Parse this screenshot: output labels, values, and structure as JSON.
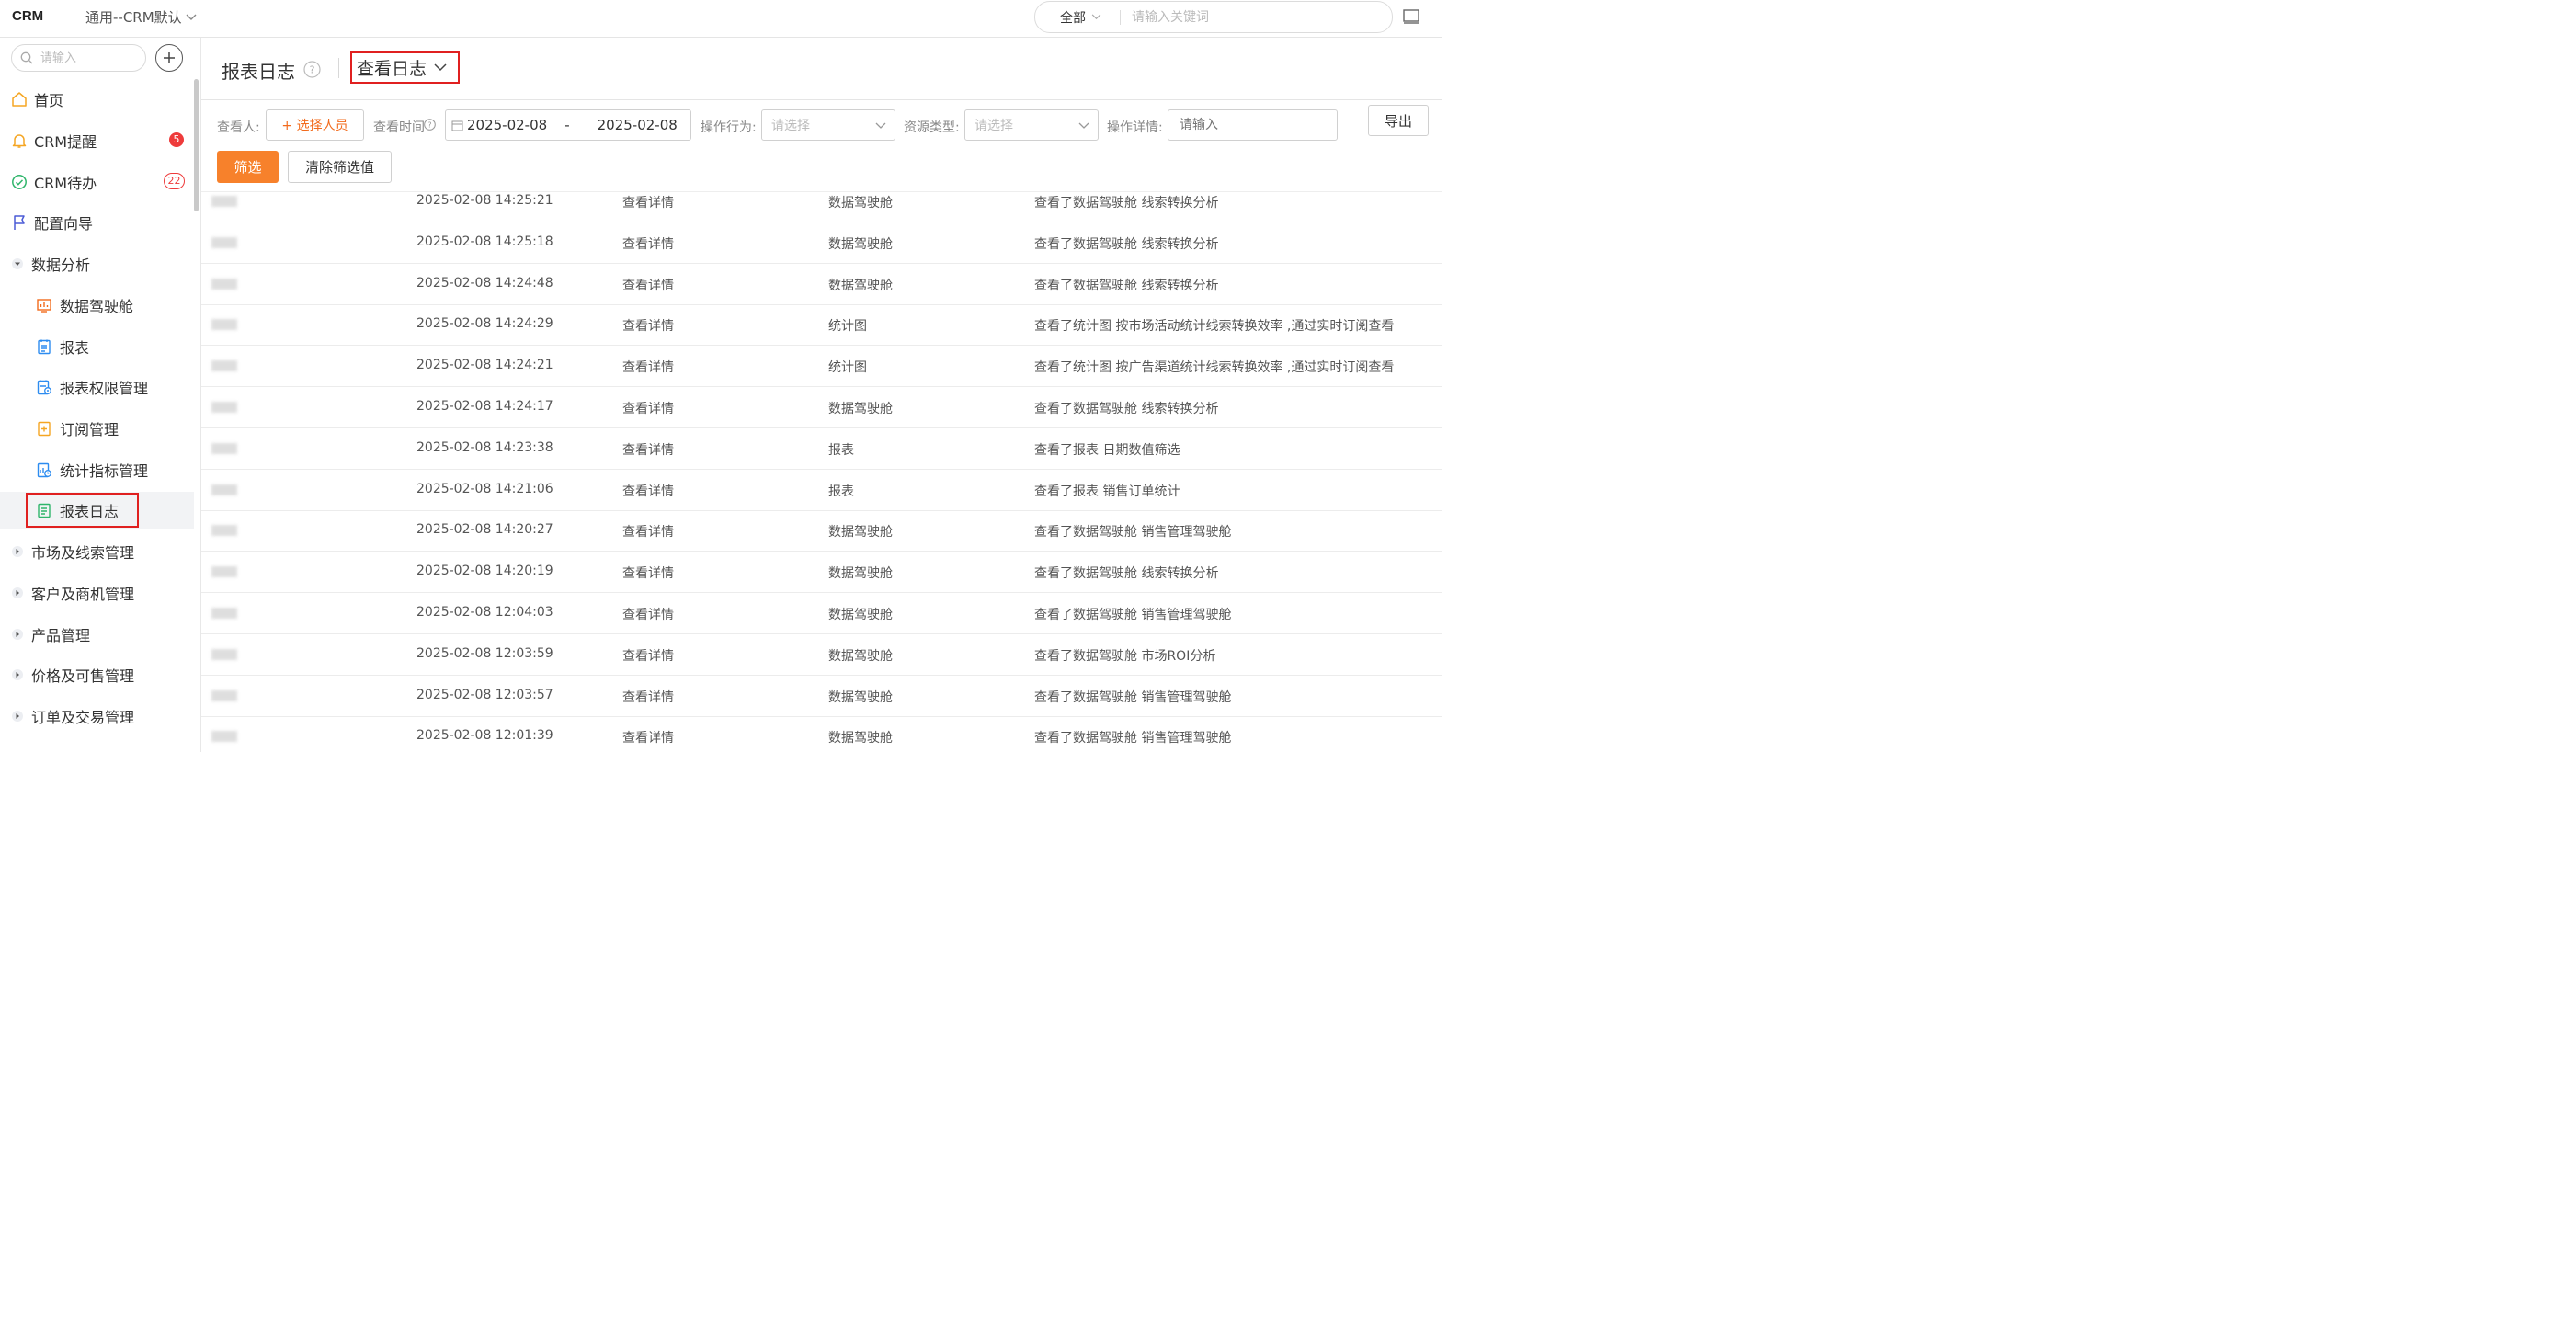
{
  "topbar": {
    "logo": "CRM",
    "app_name": "通用--CRM默认",
    "search_scope": "全部",
    "search_placeholder": "请输入关键词"
  },
  "sidebar": {
    "search_placeholder": "请输入",
    "items": [
      {
        "label": "首页"
      },
      {
        "label": "CRM提醒",
        "badge": "5"
      },
      {
        "label": "CRM待办",
        "badge": "22"
      },
      {
        "label": "配置向导"
      },
      {
        "label": "数据分析",
        "expanded": true
      },
      {
        "label": "数据驾驶舱"
      },
      {
        "label": "报表"
      },
      {
        "label": "报表权限管理"
      },
      {
        "label": "订阅管理"
      },
      {
        "label": "统计指标管理"
      },
      {
        "label": "报表日志",
        "active": true
      },
      {
        "label": "市场及线索管理"
      },
      {
        "label": "客户及商机管理"
      },
      {
        "label": "产品管理"
      },
      {
        "label": "价格及可售管理"
      },
      {
        "label": "订单及交易管理"
      }
    ]
  },
  "main": {
    "title": "报表日志",
    "view_switch": "查看日志",
    "filters": {
      "viewer_label": "查看人:",
      "viewer_button": "+ 选择人员",
      "time_label": "查看时间",
      "date_start": "2025-02-08",
      "date_sep": "-",
      "date_end": "2025-02-08",
      "action_label": "操作行为:",
      "action_placeholder": "请选择",
      "resource_label": "资源类型:",
      "resource_placeholder": "请选择",
      "detail_label": "操作详情:",
      "detail_placeholder": "请输入",
      "export": "导出",
      "filter": "筛选",
      "clear": "清除筛选值"
    },
    "rows": [
      {
        "time": "2025-02-08 14:25:21",
        "action": "查看详情",
        "type": "数据驾驶舱",
        "detail": "查看了数据驾驶舱 线索转换分析"
      },
      {
        "time": "2025-02-08 14:25:18",
        "action": "查看详情",
        "type": "数据驾驶舱",
        "detail": "查看了数据驾驶舱 线索转换分析"
      },
      {
        "time": "2025-02-08 14:24:48",
        "action": "查看详情",
        "type": "数据驾驶舱",
        "detail": "查看了数据驾驶舱 线索转换分析"
      },
      {
        "time": "2025-02-08 14:24:29",
        "action": "查看详情",
        "type": "统计图",
        "detail": "查看了统计图 按市场活动统计线索转换效率 ,通过实时订阅查看"
      },
      {
        "time": "2025-02-08 14:24:21",
        "action": "查看详情",
        "type": "统计图",
        "detail": "查看了统计图 按广告渠道统计线索转换效率 ,通过实时订阅查看"
      },
      {
        "time": "2025-02-08 14:24:17",
        "action": "查看详情",
        "type": "数据驾驶舱",
        "detail": "查看了数据驾驶舱 线索转换分析"
      },
      {
        "time": "2025-02-08 14:23:38",
        "action": "查看详情",
        "type": "报表",
        "detail": "查看了报表 日期数值筛选"
      },
      {
        "time": "2025-02-08 14:21:06",
        "action": "查看详情",
        "type": "报表",
        "detail": "查看了报表 销售订单统计"
      },
      {
        "time": "2025-02-08 14:20:27",
        "action": "查看详情",
        "type": "数据驾驶舱",
        "detail": "查看了数据驾驶舱 销售管理驾驶舱"
      },
      {
        "time": "2025-02-08 14:20:19",
        "action": "查看详情",
        "type": "数据驾驶舱",
        "detail": "查看了数据驾驶舱 线索转换分析"
      },
      {
        "time": "2025-02-08 12:04:03",
        "action": "查看详情",
        "type": "数据驾驶舱",
        "detail": "查看了数据驾驶舱 销售管理驾驶舱"
      },
      {
        "time": "2025-02-08 12:03:59",
        "action": "查看详情",
        "type": "数据驾驶舱",
        "detail": "查看了数据驾驶舱 市场ROI分析"
      },
      {
        "time": "2025-02-08 12:03:57",
        "action": "查看详情",
        "type": "数据驾驶舱",
        "detail": "查看了数据驾驶舱 销售管理驾驶舱"
      },
      {
        "time": "2025-02-08 12:01:39",
        "action": "查看详情",
        "type": "数据驾驶舱",
        "detail": "查看了数据驾驶舱 销售管理驾驶舱"
      }
    ]
  },
  "colors": {
    "accent_orange": "#f7812b",
    "highlight_red": "#e02020",
    "badge_red": "#ee3b3b"
  }
}
